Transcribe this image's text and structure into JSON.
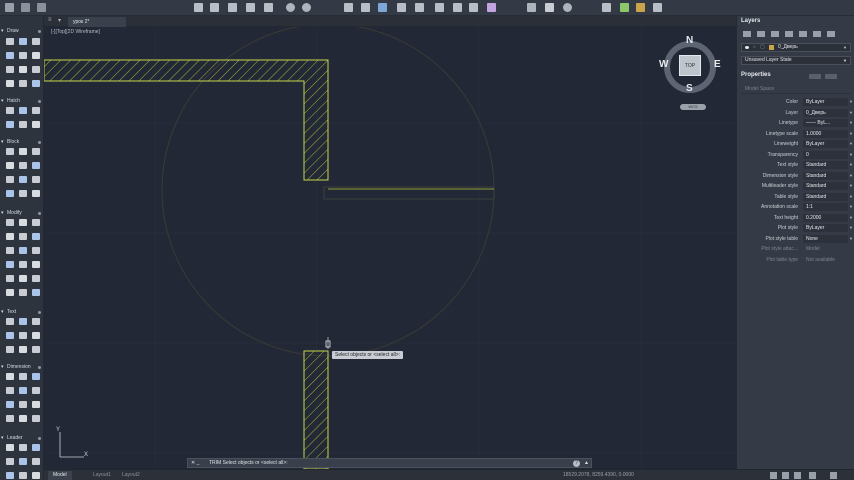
{
  "tabs": {
    "document": "урок 2*"
  },
  "viewport": {
    "view": "Top",
    "style": "2D Wireframe",
    "label": "[-][Top][2D Wireframe]"
  },
  "viewcube": {
    "top": "TOP",
    "north": "N",
    "south": "S",
    "east": "E",
    "west": "W",
    "wcs": "WCS"
  },
  "prompt": {
    "text": "Select objects or <select all>:"
  },
  "cmdline": {
    "close": "✕ _",
    "text": "TRIM Select objects or <select all>:",
    "help": "?",
    "expand": "▲"
  },
  "statusbar": {
    "tabs": [
      "Model",
      "Layout1",
      "Layout2"
    ],
    "coords": "18529.2078, 8259.4390, 0.0000"
  },
  "palette": {
    "sections": [
      "Draw",
      "Hatch",
      "Block",
      "Modify",
      "Text",
      "Dimension",
      "Leader"
    ]
  },
  "layers": {
    "title": "Layers",
    "current": "0_Дверь",
    "state": "Unsaved Layer State"
  },
  "properties": {
    "title": "Properties",
    "selection": "Model Space",
    "rows": [
      {
        "label": "Color",
        "value": "ByLayer"
      },
      {
        "label": "Layer",
        "value": "0_Дверь"
      },
      {
        "label": "Linetype",
        "value": "—— ByL..."
      },
      {
        "label": "Linetype scale",
        "value": "1.0000"
      },
      {
        "label": "Lineweight",
        "value": "ByLayer"
      },
      {
        "label": "Transparency",
        "value": "0"
      },
      {
        "label": "Text style",
        "value": "Standard"
      },
      {
        "label": "Dimension style",
        "value": "Standard"
      },
      {
        "label": "Multileader style",
        "value": "Standard"
      },
      {
        "label": "Table style",
        "value": "Standard"
      },
      {
        "label": "Annotation scale",
        "value": "1:1"
      },
      {
        "label": "Text height",
        "value": "0.2000"
      },
      {
        "label": "Plot style",
        "value": "ByLayer"
      },
      {
        "label": "Plot style table",
        "value": "None"
      },
      {
        "label": "Plot style attac...",
        "value": "Model"
      },
      {
        "label": "Plot table type",
        "value": "Not available"
      }
    ]
  },
  "colors": {
    "hatch": "#b5c63a",
    "background": "#222835",
    "panel": "#353b46"
  }
}
